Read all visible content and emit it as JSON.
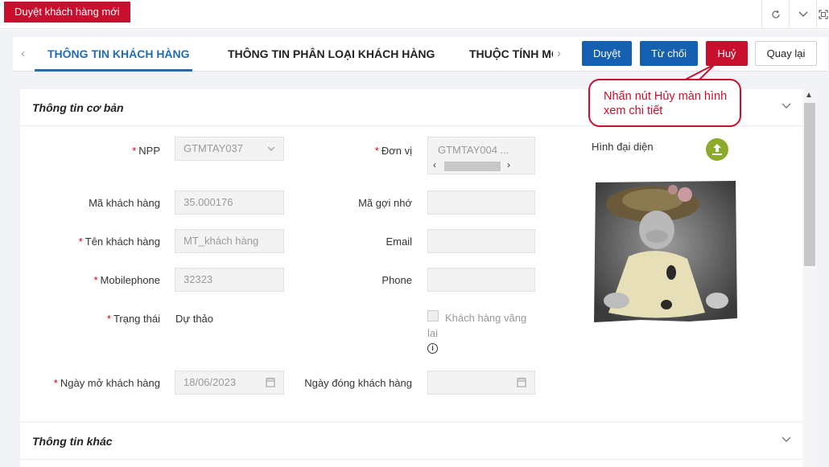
{
  "window": {
    "title": "Duyệt khách hàng mới"
  },
  "tabs": [
    {
      "label": "THÔNG TIN KHÁCH HÀNG",
      "active": true
    },
    {
      "label": "THÔNG TIN PHÂN LOẠI KHÁCH HÀNG",
      "active": false
    },
    {
      "label": "THUỘC TÍNH MỞ",
      "active": false
    }
  ],
  "actions": {
    "approve": "Duyệt",
    "reject": "Từ chối",
    "cancel": "Huỷ",
    "back": "Quay lại"
  },
  "callout": {
    "text": "Nhấn nút Hủy màn hình xem chi tiết"
  },
  "basic_section": {
    "title": "Thông tin cơ bản",
    "fields": {
      "npp": {
        "label": "NPP",
        "value": "GTMTAY037"
      },
      "don_vi": {
        "label": "Đơn vị",
        "value": "GTMTAY004 ..."
      },
      "ma_kh": {
        "label": "Mã khách hàng",
        "value": "35.000176"
      },
      "ma_goi_nho": {
        "label": "Mã gợi nhớ",
        "value": ""
      },
      "ten_kh": {
        "label": "Tên khách hàng",
        "value": "MT_khách hàng"
      },
      "email": {
        "label": "Email",
        "value": ""
      },
      "mobile": {
        "label": "Mobilephone",
        "value": "32323"
      },
      "phone": {
        "label": "Phone",
        "value": ""
      },
      "trang_thai": {
        "label": "Trạng thái",
        "value": "Dự thảo"
      },
      "vang_lai": {
        "label": "Khách hàng vãng lai",
        "checked": false
      },
      "ngay_mo": {
        "label": "Ngày mở khách hàng",
        "value": "18/06/2023"
      },
      "ngay_dong": {
        "label": "Ngày đóng khách hàng",
        "value": ""
      }
    },
    "avatar_label": "Hình đại diện"
  },
  "other_section": {
    "title": "Thông tin khác"
  },
  "colors": {
    "brand_red": "#c8102e",
    "primary_blue": "#1560b0",
    "active_tab": "#1f6db5",
    "upload_green": "#8cab2a"
  }
}
